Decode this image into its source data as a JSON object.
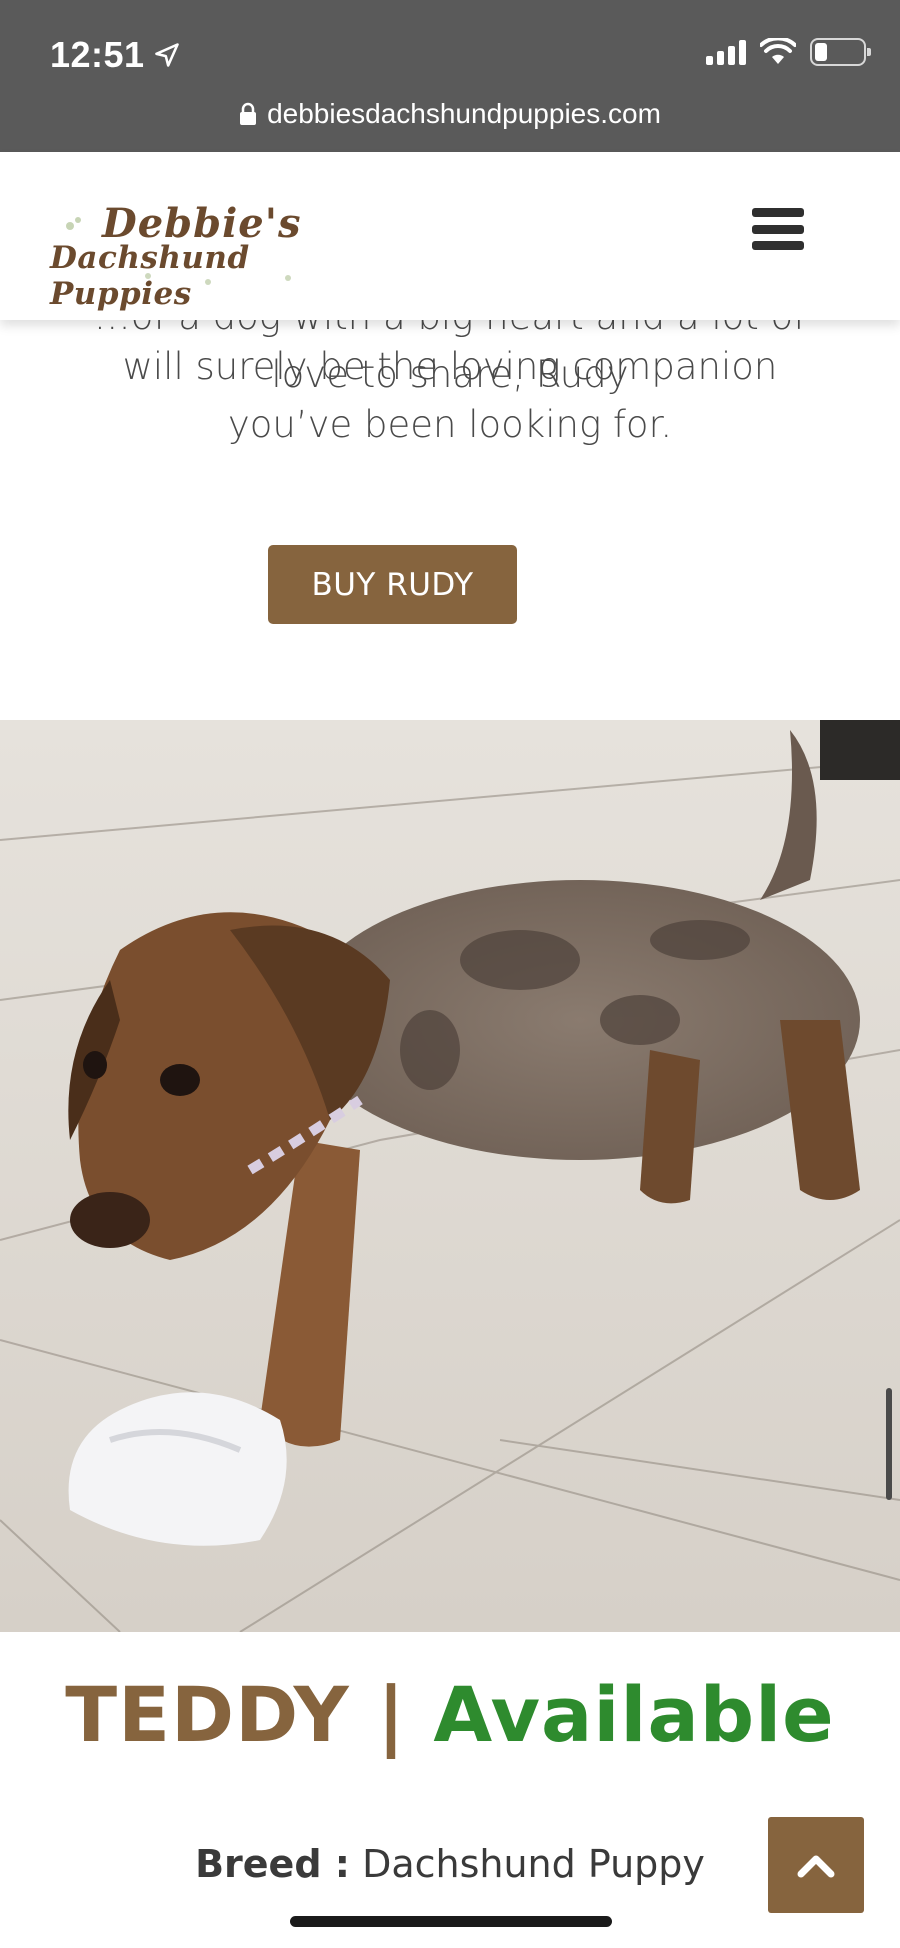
{
  "status_bar": {
    "time": "12:51",
    "url": "debbiesdachshundpuppies.com"
  },
  "header": {
    "logo_line1": "Debbie's",
    "logo_line2": "Dachshund Puppies",
    "menu_icon": "hamburger-menu-icon"
  },
  "previous_listing": {
    "description_cut": "…of a dog with a big heart and a lot of love to share, Rudy",
    "description": "will surely be the loving companion you’ve been looking for.",
    "buy_label": "BUY RUDY"
  },
  "listing": {
    "name": "TEDDY",
    "separator": "|",
    "status": "Available",
    "breed_label": "Breed :",
    "breed_value": "Dachshund Puppy"
  },
  "colors": {
    "brand_brown": "#86643e",
    "available_green": "#2e8b2e",
    "chrome_gray": "#5a5a5a"
  }
}
